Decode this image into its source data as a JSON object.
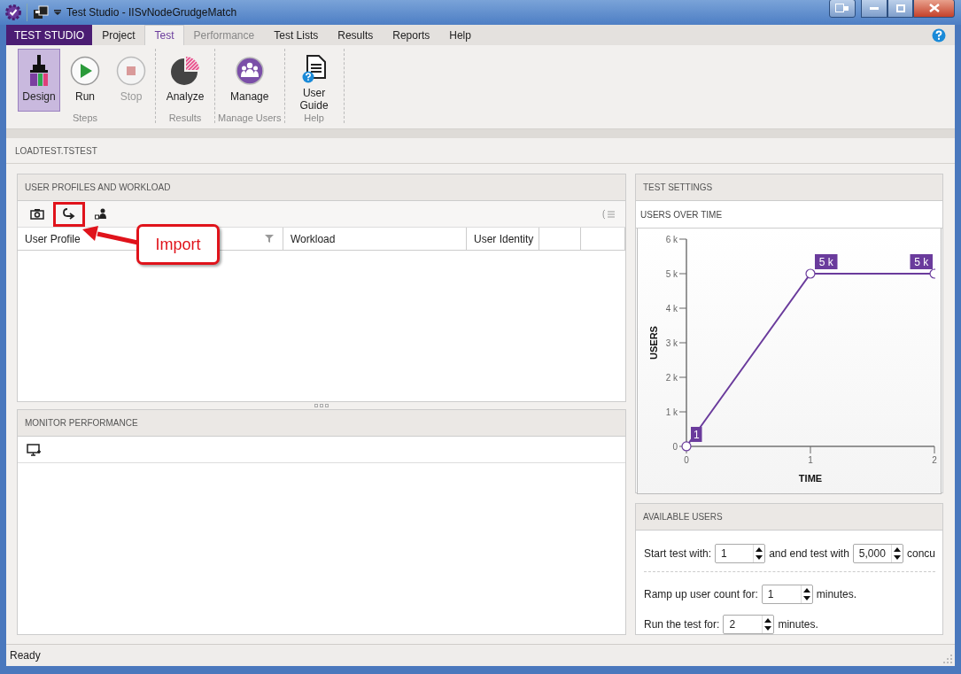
{
  "window": {
    "title": "Test Studio - IISvNodeGrudgeMatch"
  },
  "app_tab": "TEST STUDIO",
  "tabs": [
    {
      "label": "Project",
      "selected": false,
      "disabled": false
    },
    {
      "label": "Test",
      "selected": true,
      "disabled": false
    },
    {
      "label": "Performance",
      "selected": false,
      "disabled": true
    },
    {
      "label": "Test Lists",
      "selected": false,
      "disabled": false
    },
    {
      "label": "Results",
      "selected": false,
      "disabled": false
    },
    {
      "label": "Reports",
      "selected": false,
      "disabled": false
    },
    {
      "label": "Help",
      "selected": false,
      "disabled": false
    }
  ],
  "ribbon": {
    "groups": [
      {
        "label": "Steps",
        "buttons": [
          {
            "label": "Design",
            "kind": "design",
            "selected": true,
            "disabled": false
          },
          {
            "label": "Run",
            "kind": "run",
            "selected": false,
            "disabled": false
          },
          {
            "label": "Stop",
            "kind": "stop",
            "selected": false,
            "disabled": true
          }
        ]
      },
      {
        "label": "Results",
        "buttons": [
          {
            "label": "Analyze",
            "kind": "analyze",
            "selected": false,
            "disabled": false
          }
        ]
      },
      {
        "label": "Manage Users",
        "buttons": [
          {
            "label": "Manage",
            "kind": "manage",
            "selected": false,
            "disabled": false
          }
        ]
      },
      {
        "label": "Help",
        "buttons": [
          {
            "label": "User Guide",
            "kind": "guide",
            "selected": false,
            "disabled": false
          }
        ]
      }
    ]
  },
  "document_tab": "LOADTEST.TSTEST",
  "profiles": {
    "title": "USER PROFILES AND WORKLOAD",
    "tools": [
      {
        "kind": "camera",
        "highlighted": false
      },
      {
        "kind": "import",
        "highlighted": true
      },
      {
        "kind": "user",
        "highlighted": false
      }
    ],
    "columns": [
      "User Profile",
      "Workload",
      "User Identity"
    ]
  },
  "callout": {
    "text": "Import"
  },
  "monitor": {
    "title": "MONITOR PERFORMANCE"
  },
  "settings": {
    "title": "TEST SETTINGS",
    "subtitle": "USERS OVER TIME",
    "chart_data": {
      "type": "line",
      "xlabel": "TIME",
      "ylabel": "USERS",
      "x": [
        0,
        1,
        2
      ],
      "series": [
        {
          "color": "#6a3b9c",
          "marker": "circle",
          "values": [
            1,
            5000,
            5000
          ]
        }
      ],
      "xlim": [
        0,
        2
      ],
      "ylim": [
        0,
        6000
      ],
      "xticks": [
        0,
        1,
        2
      ],
      "yticks": [
        {
          "value": 0,
          "label": "0"
        },
        {
          "value": 1000,
          "label": "1 k"
        },
        {
          "value": 2000,
          "label": "2 k"
        },
        {
          "value": 3000,
          "label": "3 k"
        },
        {
          "value": 4000,
          "label": "4 k"
        },
        {
          "value": 5000,
          "label": "5 k"
        },
        {
          "value": 6000,
          "label": "6 k"
        }
      ],
      "value_labels": [
        "1",
        "5 k",
        "5 k"
      ]
    }
  },
  "available": {
    "title": "AVAILABLE USERS",
    "rows": [
      [
        {
          "kind": "label",
          "text": "Start test with:"
        },
        {
          "kind": "spinner",
          "text": "1"
        },
        {
          "kind": "label",
          "text": "and end test with"
        },
        {
          "kind": "spinner",
          "text": "5,000"
        },
        {
          "kind": "label",
          "text": "concu"
        }
      ],
      [
        {
          "kind": "label",
          "text": "Ramp up user count for:"
        },
        {
          "kind": "spinner",
          "text": "1"
        },
        {
          "kind": "label",
          "text": "minutes."
        }
      ],
      [
        {
          "kind": "label",
          "text": "Run the test for:"
        },
        {
          "kind": "spinner",
          "text": "2"
        },
        {
          "kind": "label",
          "text": "minutes."
        }
      ]
    ]
  },
  "status_bar": "Ready"
}
